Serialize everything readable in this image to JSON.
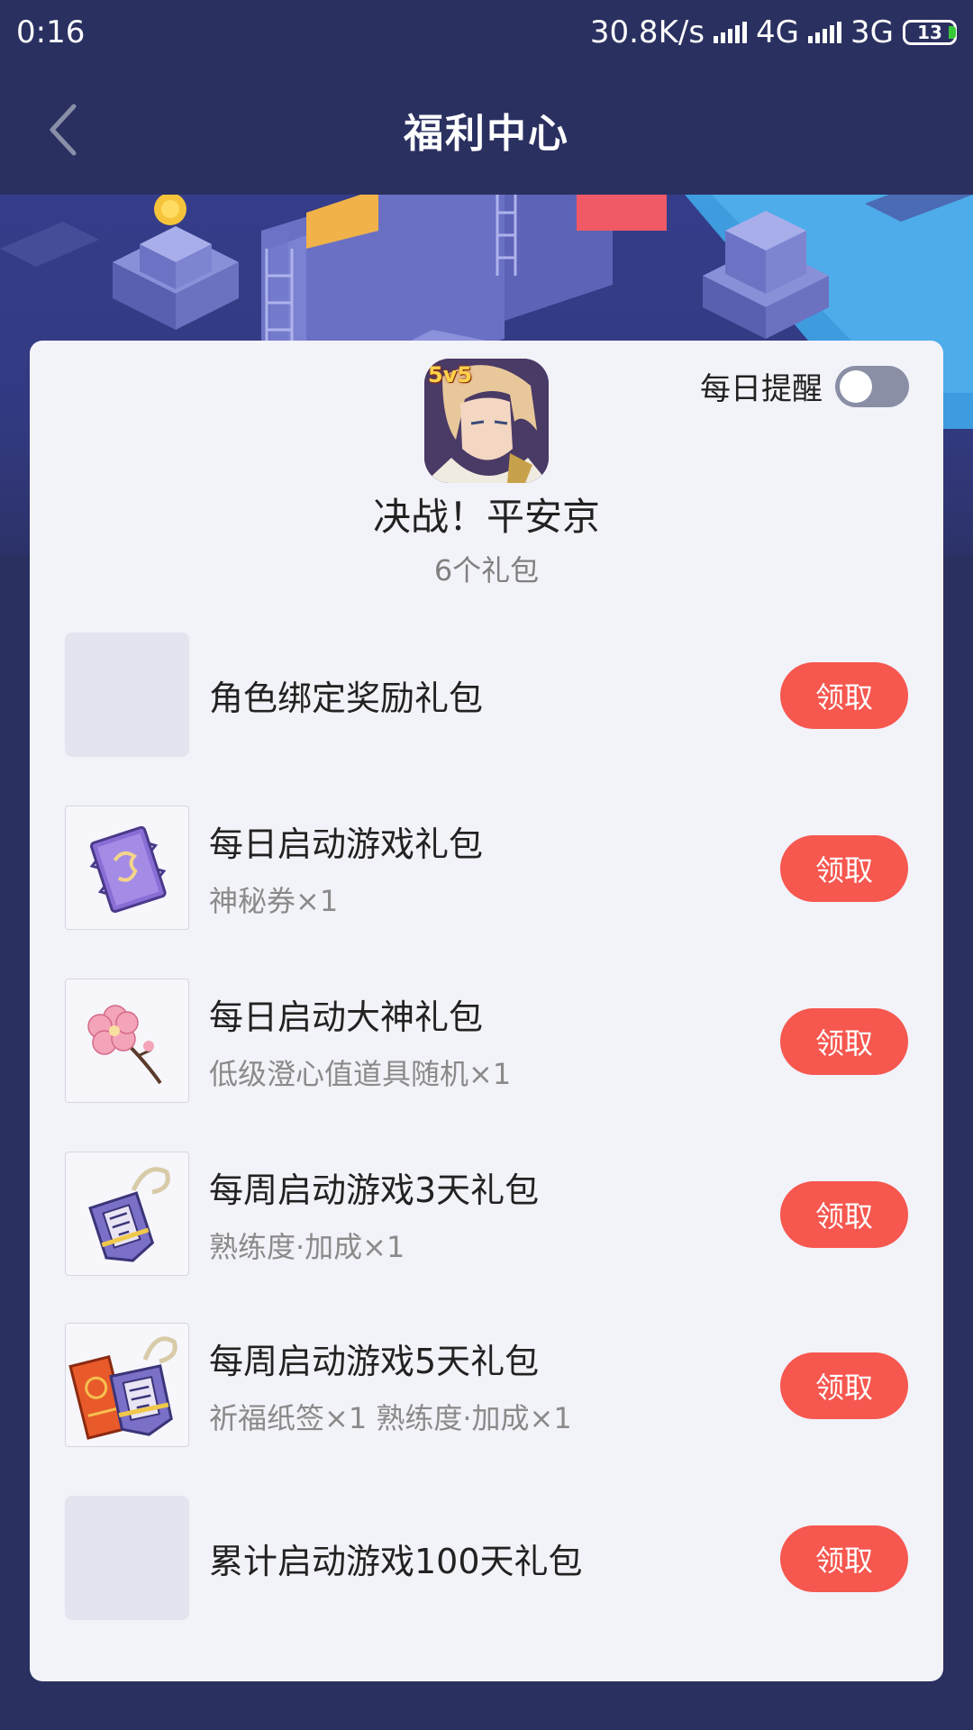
{
  "status_bar": {
    "time": "0:16",
    "speed": "30.8K/s",
    "network1": "4G",
    "network2": "3G",
    "battery": "13"
  },
  "header": {
    "title": "福利中心",
    "back_icon": "chevron-left-icon"
  },
  "game": {
    "badge": "5v5",
    "name": "决战！平安京",
    "gift_count": "6个礼包"
  },
  "reminder": {
    "label": "每日提醒",
    "enabled": false
  },
  "gifts": [
    {
      "name": "角色绑定奖励礼包",
      "desc": "",
      "button": "领取",
      "icon": "blank"
    },
    {
      "name": "每日启动游戏礼包",
      "desc": "神秘券×1",
      "button": "领取",
      "icon": "mystery-ticket-icon"
    },
    {
      "name": "每日启动大神礼包",
      "desc": "低级澄心值道具随机×1",
      "button": "领取",
      "icon": "sakura-branch-icon"
    },
    {
      "name": "每周启动游戏3天礼包",
      "desc": "熟练度·加成×1",
      "button": "领取",
      "icon": "charm-amulet-icon"
    },
    {
      "name": "每周启动游戏5天礼包",
      "desc": "祈福纸签×1 熟练度·加成×1",
      "button": "领取",
      "icon": "paper-slip-amulet-icon"
    },
    {
      "name": "累计启动游戏100天礼包",
      "desc": "",
      "button": "领取",
      "icon": "blank"
    }
  ],
  "colors": {
    "background": "#2a3060",
    "card": "#f2f2f9",
    "claim_button": "#f6574f"
  }
}
